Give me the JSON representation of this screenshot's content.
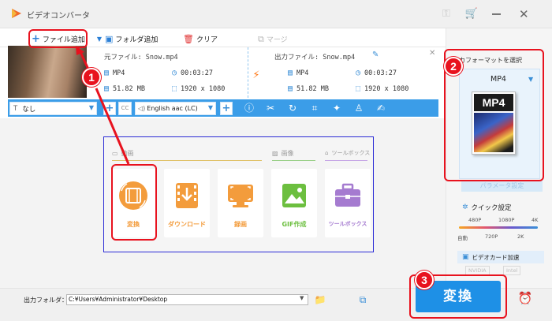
{
  "app": {
    "title": "ビデオコンバータ"
  },
  "toolbar": {
    "add_file": "ファイル追加",
    "add_folder": "フォルダ追加",
    "clear": "クリア",
    "merge": "マージ"
  },
  "file": {
    "source_label": "元ファイル: Snow.mp4",
    "source_format": "MP4",
    "source_duration": "00:03:27",
    "source_size": "51.82 MB",
    "source_resolution": "1920 x 1080",
    "output_label": "出力ファイル: Snow.mp4",
    "output_format": "MP4",
    "output_duration": "00:03:27",
    "output_size": "51.82 MB",
    "output_resolution": "1920 x 1080"
  },
  "editbar": {
    "subtitle_value": "なし",
    "audio_value": "English aac (LC)"
  },
  "sections": {
    "video": "動画",
    "image": "画像",
    "toolbox": "ツールボックス"
  },
  "cards": [
    {
      "label": "変換",
      "color": "#f39c3c"
    },
    {
      "label": "ダウンロード",
      "color": "#f39c3c"
    },
    {
      "label": "録画",
      "color": "#f39c3c"
    },
    {
      "label": "GIF作成",
      "color": "#6cbf3f"
    },
    {
      "label": "ツールボックス",
      "color": "#a57bd0"
    }
  ],
  "right_panel": {
    "title": "カフォーマットを選択",
    "selected_format": "MP4",
    "params_button": "パラメータ設定",
    "quick_settings": "クイック設定",
    "quality_top": [
      "480P",
      "1080P",
      "4K"
    ],
    "quality_bottom": [
      "自動",
      "720P",
      "2K"
    ],
    "gpu_accel": "ビデオカード加速",
    "gpu_vendors": [
      "NVIDIA",
      "Intel"
    ]
  },
  "bottom": {
    "output_folder_label": "出力フォルダ：",
    "output_path": "C:¥Users¥Administrator¥Desktop",
    "convert": "変換"
  },
  "annotations": [
    "1",
    "2",
    "3"
  ],
  "colors": {
    "accent": "#3b9de8",
    "highlight_red": "#e8121e",
    "feature_box_border": "#2b2bd6"
  }
}
